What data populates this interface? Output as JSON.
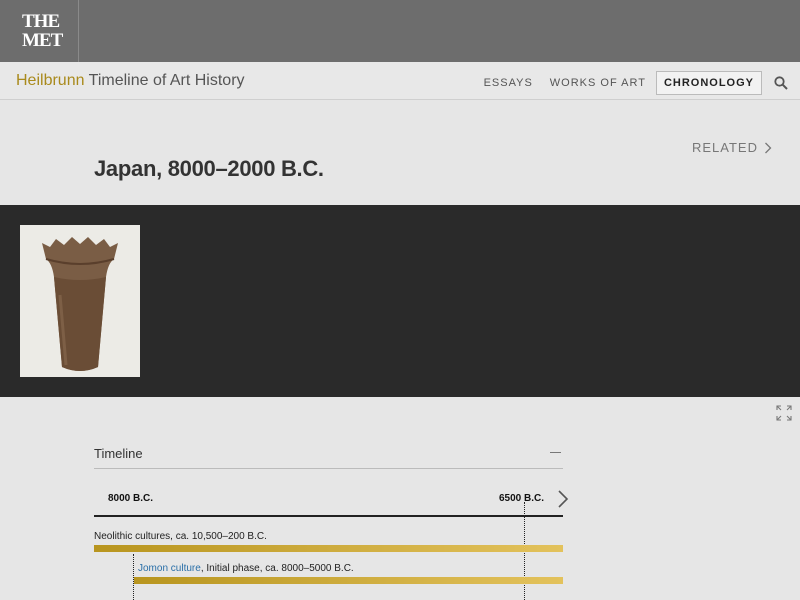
{
  "logo": {
    "line1": "THE",
    "line2": "MET"
  },
  "nav": {
    "brand_accent": "Heilbrunn",
    "brand_rest": " Timeline of Art History",
    "links": [
      {
        "label": "ESSAYS",
        "active": false
      },
      {
        "label": "WORKS OF ART",
        "active": false
      },
      {
        "label": "CHRONOLOGY",
        "active": true
      }
    ],
    "search_icon": "search-icon"
  },
  "header": {
    "related_label": "RELATED",
    "title": "Japan, 8000–2000 B.C."
  },
  "timeline": {
    "label": "Timeline",
    "start_label": "8000 B.C.",
    "end_label": "6500 B.C.",
    "rows": [
      {
        "text": "Neolithic cultures, ca. 10,500–200 B.C.",
        "link": ""
      },
      {
        "link": "Jomon culture",
        "text": ", Initial phase, ca. 8000–5000 B.C."
      }
    ]
  },
  "colors": {
    "accent": "#a98a1c",
    "link": "#2a6fa8",
    "bar": "#c9a532",
    "band": "#2a2a2a",
    "topbar": "#6d6d6d"
  }
}
